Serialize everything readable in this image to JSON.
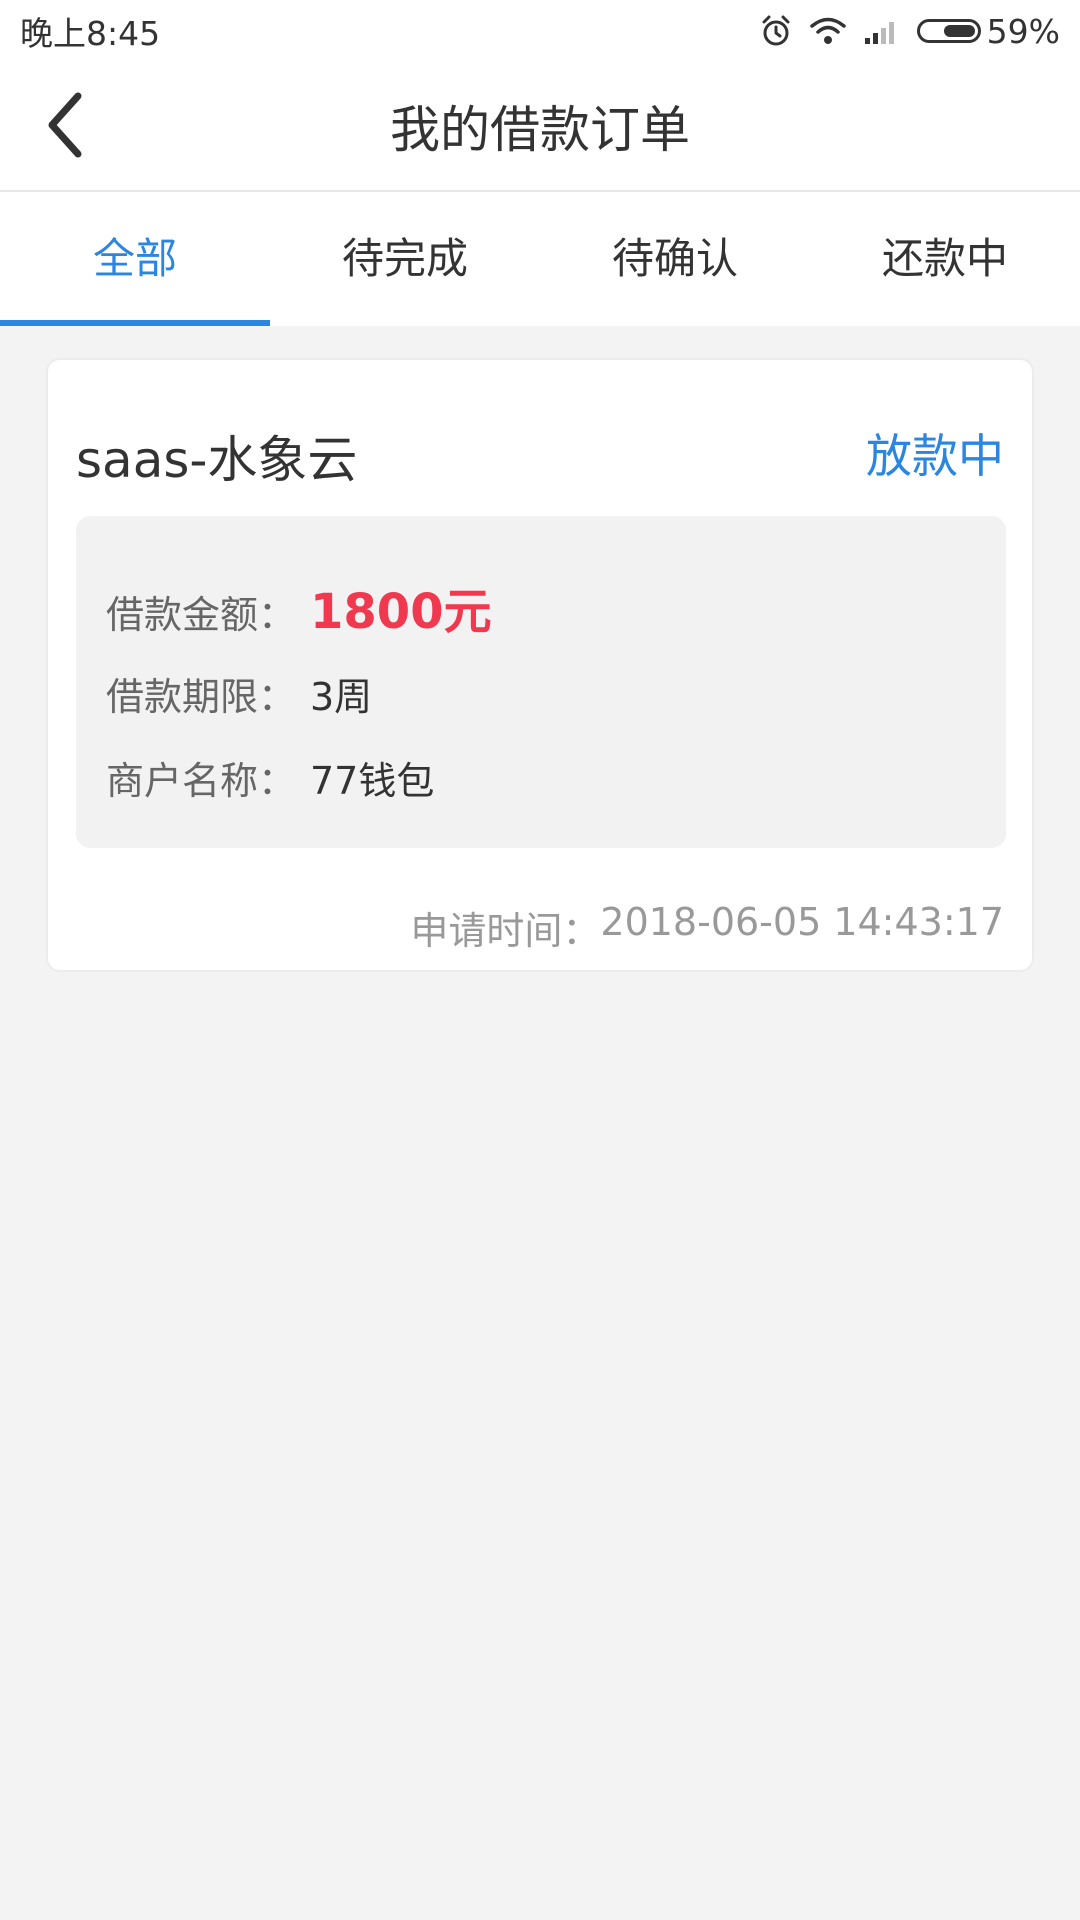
{
  "status_bar": {
    "time": "晚上8:45",
    "battery_percent": "59%",
    "battery_level": 0.59,
    "icons": [
      "alarm-icon",
      "wifi-icon",
      "signal-icon",
      "battery-icon"
    ]
  },
  "header": {
    "title": "我的借款订单",
    "back_icon": "chevron-left-icon"
  },
  "tabs": [
    {
      "label": "全部",
      "active": true
    },
    {
      "label": "待完成",
      "active": false
    },
    {
      "label": "待确认",
      "active": false
    },
    {
      "label": "还款中",
      "active": false
    }
  ],
  "order": {
    "platform": "saas-水象云",
    "status": "放款中",
    "amount_label": "借款金额：",
    "amount_value": "1800元",
    "term_label": "借款期限：",
    "term_value": "3周",
    "merchant_label": "商户名称：",
    "merchant_value": "77钱包",
    "apply_time_label": "申请时间：",
    "apply_time_value": "2018-06-05 14:43:17"
  },
  "colors": {
    "accent": "#2a86e0",
    "amount": "#f0384f",
    "background": "#f3f3f3"
  }
}
